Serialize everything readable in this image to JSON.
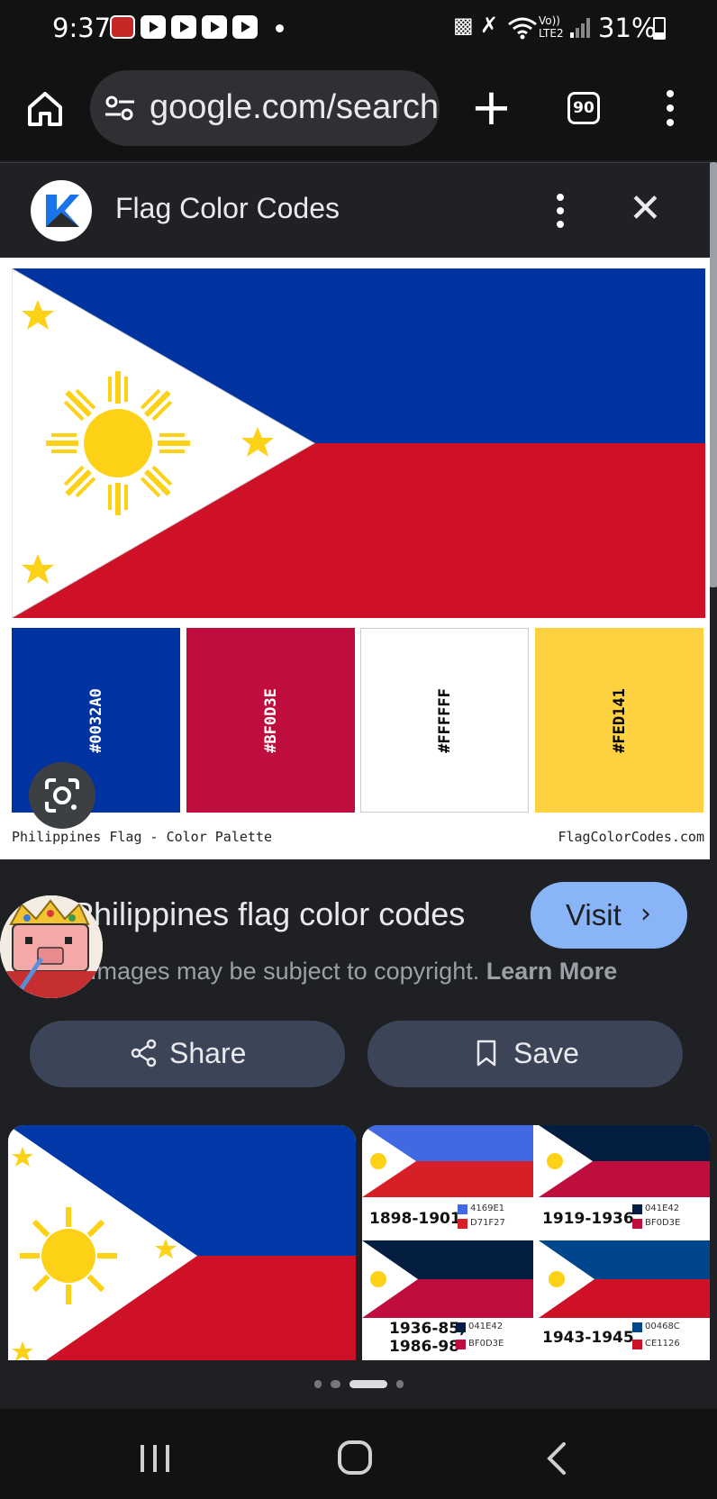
{
  "status_bar": {
    "time": "9:37",
    "network_label_top": "Vo))",
    "network_label_bottom": "LTE2",
    "battery_percent": "31%"
  },
  "browser": {
    "url": "google.com/search",
    "tab_count": "90",
    "icons": [
      "home-icon",
      "tune-icon",
      "plus-icon",
      "tabs-icon",
      "more-vert-icon"
    ]
  },
  "panel": {
    "title": "Flag Color Codes"
  },
  "main_image": {
    "swatches": [
      {
        "hex": "#0032A0",
        "color": "#0032A0",
        "text_color": "#ffffff"
      },
      {
        "hex": "#BF0D3E",
        "color": "#BF0D3E",
        "text_color": "#ffffff"
      },
      {
        "hex": "#FFFFFF",
        "color": "#FFFFFF",
        "text_color": "#000000"
      },
      {
        "hex": "#FED141",
        "color": "#FED141",
        "text_color": "#000000"
      }
    ],
    "caption_left": "Philippines Flag - Color Palette",
    "caption_right": "FlagColorCodes.com"
  },
  "result": {
    "title": "Philippines flag color codes",
    "visit_label": "Visit",
    "copyright_text": "Images may be subject to copyright.",
    "learn_more": "Learn More"
  },
  "actions": {
    "share_label": "Share",
    "save_label": "Save"
  },
  "related": {
    "history": [
      {
        "era": "1898-1901",
        "hex1": "4169E1",
        "hex2": "D71F27",
        "c1": "#4169E1",
        "c2": "#D71F27"
      },
      {
        "era": "1919-1936",
        "hex1": "041E42",
        "hex2": "BF0D3E",
        "c1": "#041E42",
        "c2": "#BF0D3E"
      },
      {
        "era_line1": "1936-85;",
        "era_line2": "1986-98",
        "hex1": "041E42",
        "hex2": "BF0D3E",
        "c1": "#041E42",
        "c2": "#BF0D3E"
      },
      {
        "era": "1943-1945",
        "hex1": "00468C",
        "hex2": "CE1126",
        "c1": "#00468C",
        "c2": "#CE1126"
      }
    ]
  },
  "colors": {
    "accent": "#8ab4f8",
    "flag_blue": "#0032A0",
    "flag_red": "#CE1126",
    "flag_yellow": "#FCD116"
  }
}
